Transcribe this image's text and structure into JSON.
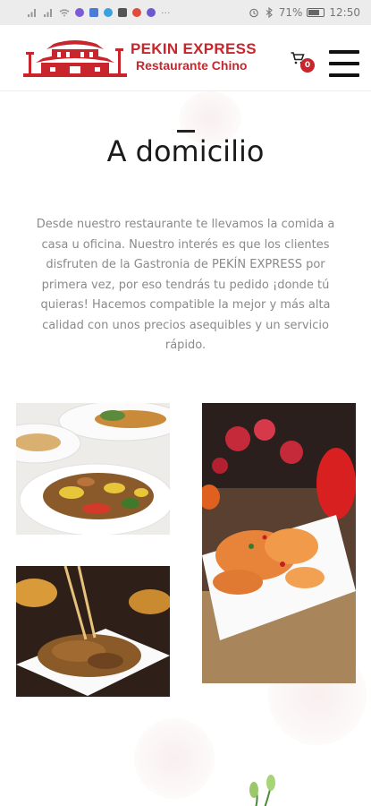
{
  "status_bar": {
    "battery": "71%",
    "time": "12:50",
    "battery_level": 0.71
  },
  "header": {
    "logo_title": "PEKIN EXPRESS",
    "logo_subtitle": "Restaurante Chino",
    "cart_count": "0"
  },
  "main": {
    "title": "A domicilio",
    "intro": "Desde nuestro restaurante te llevamos la comida a casa u oficina. Nuestro interés es que los clientes disfruten de la Gastronia de PEKÍN EXPRESS por primera vez, por eso tendrás tu pedido ¡donde tú quieras! Hacemos compatible la mejor y más alta calidad con unos precios asequibles y un servicio rápido."
  },
  "colors": {
    "brand_red": "#c8262c",
    "status_bg": "#ececec",
    "body_text": "#8a8a8a"
  },
  "icons": [
    "signal-icon",
    "wifi-icon",
    "alarm-icon",
    "bluetooth-icon",
    "battery-icon",
    "cart-icon",
    "menu-icon"
  ]
}
